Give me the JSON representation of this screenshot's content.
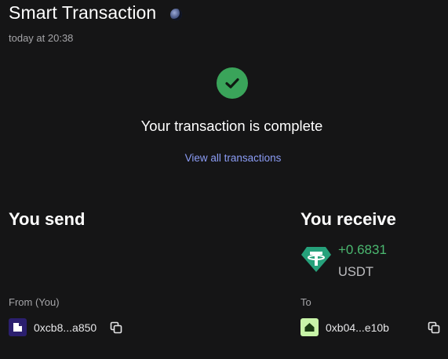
{
  "header": {
    "title": "Smart Transaction",
    "network_icon": "network-globe-icon",
    "timestamp": "today at 20:38"
  },
  "status": {
    "icon": "check-circle-icon",
    "message": "Your transaction is complete",
    "link_label": "View all transactions",
    "accent_color": "#3aa45a",
    "link_color": "#8b9cf5"
  },
  "send": {
    "heading": "You send",
    "from_label": "From (You)",
    "address": "0xcb8...a850",
    "avatar_icon": "wallet-avatar-icon",
    "copy_icon": "copy-icon"
  },
  "receive": {
    "heading": "You receive",
    "amount": "+0.6831",
    "symbol": "USDT",
    "token_icon": "tether-icon",
    "amount_color": "#4bb870",
    "to_label": "To",
    "address": "0xb04...e10b",
    "avatar_icon": "house-avatar-icon",
    "copy_icon": "copy-icon"
  }
}
